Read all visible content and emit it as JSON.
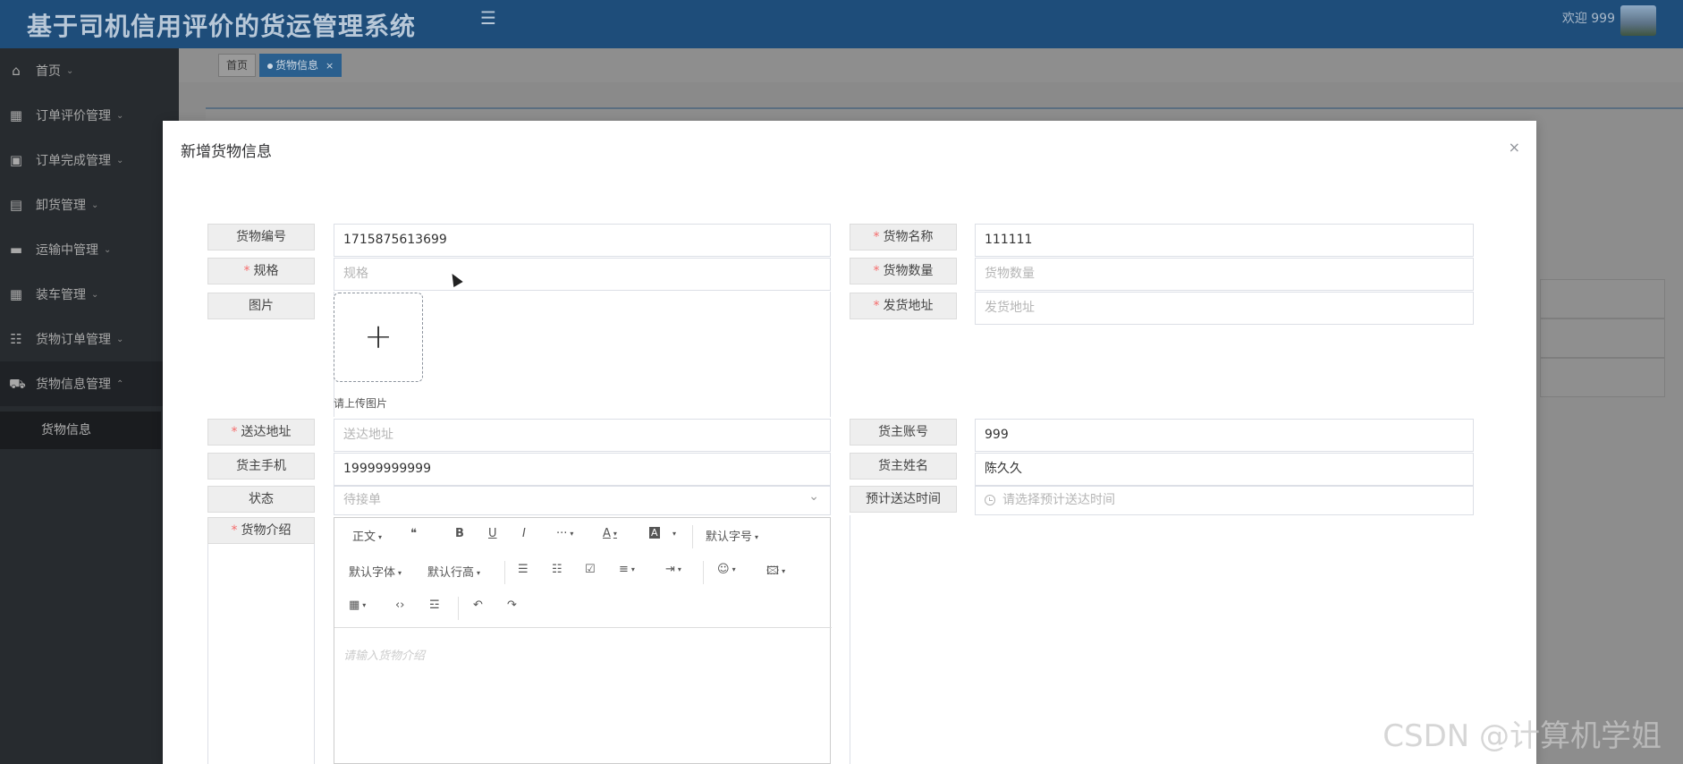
{
  "app": {
    "title": "基于司机信用评价的货运管理系统",
    "welcome": "欢迎 999"
  },
  "sidebar": {
    "items": [
      {
        "label": "首页",
        "icon": "home-icon"
      },
      {
        "label": "订单评价管理",
        "icon": "grid-icon"
      },
      {
        "label": "订单完成管理",
        "icon": "chip-icon"
      },
      {
        "label": "卸货管理",
        "icon": "briefcase-icon"
      },
      {
        "label": "运输中管理",
        "icon": "card-icon"
      },
      {
        "label": "装车管理",
        "icon": "grid-icon"
      },
      {
        "label": "货物订单管理",
        "icon": "server-icon"
      },
      {
        "label": "货物信息管理",
        "icon": "car-icon"
      }
    ],
    "sub_item": "货物信息"
  },
  "tabs": {
    "home": "首页",
    "active": "货物信息",
    "close": "×"
  },
  "modal": {
    "title": "新增货物信息",
    "close": "×",
    "form": {
      "goods_no": {
        "label": "货物编号",
        "value": "1715875613699"
      },
      "goods_name": {
        "label": "货物名称",
        "value": "111111"
      },
      "spec": {
        "label": "规格",
        "placeholder": "规格"
      },
      "goods_qty": {
        "label": "货物数量",
        "placeholder": "货物数量"
      },
      "image": {
        "label": "图片",
        "tip": "请上传图片"
      },
      "ship_addr": {
        "label": "发货地址",
        "placeholder": "发货地址"
      },
      "deliver_addr": {
        "label": "送达地址",
        "placeholder": "送达地址"
      },
      "owner_account": {
        "label": "货主账号",
        "value": "999"
      },
      "owner_phone": {
        "label": "货主手机",
        "value": "19999999999"
      },
      "owner_name": {
        "label": "货主姓名",
        "value": "陈久久"
      },
      "status": {
        "label": "状态",
        "value": "待接单"
      },
      "eta": {
        "label": "预计送达时间",
        "placeholder": "请选择预计送达时间"
      },
      "intro": {
        "label": "货物介绍",
        "placeholder": "请输入货物介绍"
      }
    },
    "editor": {
      "row1": [
        "正文",
        "❝",
        "B",
        "U",
        "I",
        "···",
        "A",
        "A",
        "默认字号"
      ],
      "row2": [
        "默认字体",
        "默认行高",
        "☰",
        "☷",
        "☑",
        "≡",
        "⇥",
        "☺",
        "🖾"
      ],
      "row3": [
        "▦",
        "‹›",
        "☲",
        "↶",
        "↷"
      ]
    }
  },
  "watermark": "CSDN @计算机学姐"
}
